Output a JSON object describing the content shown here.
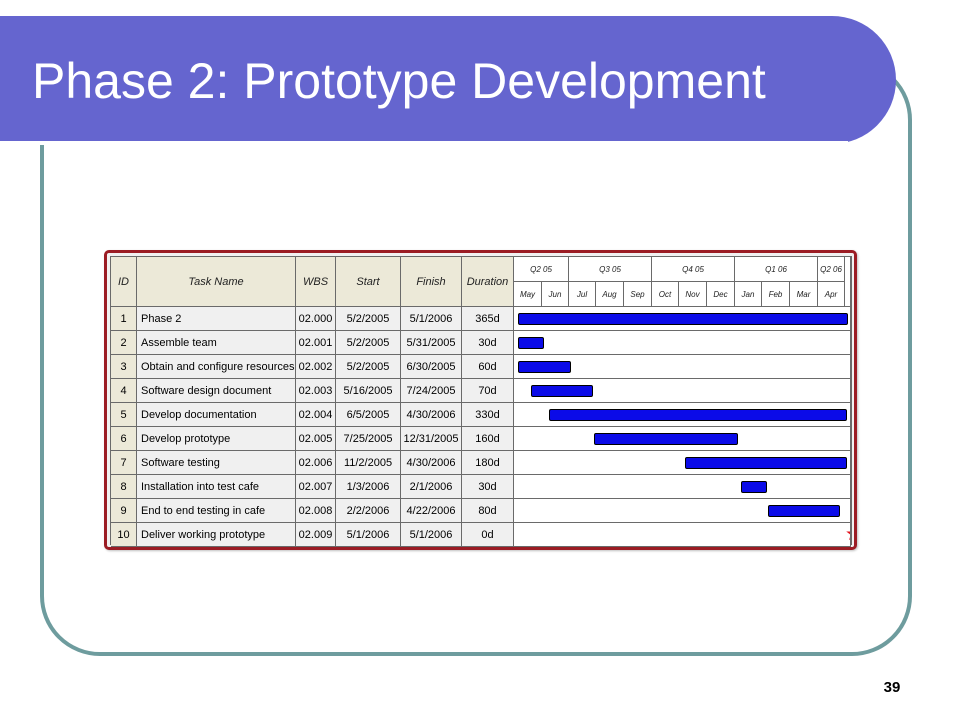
{
  "slide": {
    "title": "Phase 2: Prototype Development",
    "page_number": "39"
  },
  "gantt": {
    "headers": {
      "id": "ID",
      "task": "Task Name",
      "wbs": "WBS",
      "start": "Start",
      "finish": "Finish",
      "duration": "Duration"
    },
    "quarters": [
      "Q2 05",
      "Q3 05",
      "Q4 05",
      "Q1 06",
      "Q2 06"
    ],
    "months": [
      "May",
      "Jun",
      "Jul",
      "Aug",
      "Sep",
      "Oct",
      "Nov",
      "Dec",
      "Jan",
      "Feb",
      "Mar",
      "Apr"
    ],
    "tasks": [
      {
        "id": "1",
        "name": "Phase 2",
        "wbs": "02.000",
        "start": "5/2/2005",
        "finish": "5/1/2006",
        "duration": "365d"
      },
      {
        "id": "2",
        "name": "Assemble team",
        "wbs": "02.001",
        "start": "5/2/2005",
        "finish": "5/31/2005",
        "duration": "30d"
      },
      {
        "id": "3",
        "name": "Obtain and configure resources",
        "wbs": "02.002",
        "start": "5/2/2005",
        "finish": "6/30/2005",
        "duration": "60d"
      },
      {
        "id": "4",
        "name": "Software design document",
        "wbs": "02.003",
        "start": "5/16/2005",
        "finish": "7/24/2005",
        "duration": "70d"
      },
      {
        "id": "5",
        "name": "Develop documentation",
        "wbs": "02.004",
        "start": "6/5/2005",
        "finish": "4/30/2006",
        "duration": "330d"
      },
      {
        "id": "6",
        "name": "Develop prototype",
        "wbs": "02.005",
        "start": "7/25/2005",
        "finish": "12/31/2005",
        "duration": "160d"
      },
      {
        "id": "7",
        "name": "Software testing",
        "wbs": "02.006",
        "start": "11/2/2005",
        "finish": "4/30/2006",
        "duration": "180d"
      },
      {
        "id": "8",
        "name": "Installation into test cafe",
        "wbs": "02.007",
        "start": "1/3/2006",
        "finish": "2/1/2006",
        "duration": "30d"
      },
      {
        "id": "9",
        "name": "End to end testing in cafe",
        "wbs": "02.008",
        "start": "2/2/2006",
        "finish": "4/22/2006",
        "duration": "80d"
      },
      {
        "id": "10",
        "name": "Deliver working prototype",
        "wbs": "02.009",
        "start": "5/1/2006",
        "finish": "5/1/2006",
        "duration": "0d"
      }
    ],
    "colors": {
      "bar": "#0b0be8",
      "milestone": "#e3131c",
      "border": "#9b1c24",
      "title_bar": "#6565cf"
    },
    "milestone_icon": "star-icon"
  }
}
